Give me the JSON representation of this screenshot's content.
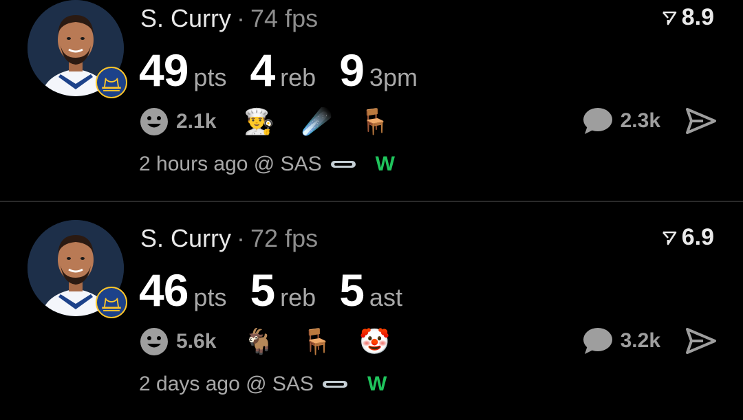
{
  "posts": [
    {
      "player": "S. Curry",
      "separator": "·",
      "fps": "74 fps",
      "rating": "8.9",
      "stats": [
        {
          "value": "49",
          "unit": "pts"
        },
        {
          "value": "4",
          "unit": "reb"
        },
        {
          "value": "9",
          "unit": "3pm"
        }
      ],
      "smile_count": "2.1k",
      "emojis": [
        "👨‍🍳",
        "☄️",
        "🪑"
      ],
      "comment_count": "2.3k",
      "time": "2 hours ago @ SAS",
      "result": "W"
    },
    {
      "player": "S. Curry",
      "separator": "·",
      "fps": "72 fps",
      "rating": "6.9",
      "stats": [
        {
          "value": "46",
          "unit": "pts"
        },
        {
          "value": "5",
          "unit": "reb"
        },
        {
          "value": "5",
          "unit": "ast"
        }
      ],
      "smile_count": "5.6k",
      "emojis": [
        "🐐",
        "🪑",
        "🤡"
      ],
      "comment_count": "3.2k",
      "time": "2 days ago @ SAS",
      "result": "W"
    }
  ],
  "colors": {
    "background": "#000000",
    "result_win": "#1fc45c",
    "muted": "#9e9e9e",
    "warriors_blue": "#1d428a",
    "warriors_gold": "#ffc72c"
  },
  "icons": {
    "rating": "rating-arrow-icon",
    "smile": "smile-icon",
    "comment": "comment-icon",
    "share": "share-icon",
    "team_logo": "warriors-logo-icon",
    "opponent_logo": "spurs-logo-icon"
  }
}
